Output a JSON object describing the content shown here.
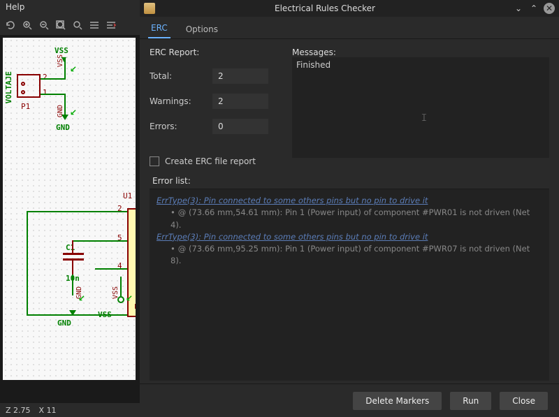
{
  "menubar": {
    "help": "Help"
  },
  "schematic": {
    "vss_top": "VSS",
    "voltaje": "VOLTAJE",
    "p1": "P1",
    "gnd_top": "GND",
    "num1": "1",
    "num2": "2",
    "u1": "U1",
    "u_num2": "2",
    "u_num5": "5",
    "u_num4": "4",
    "c1": "C1",
    "c1_val": "10n",
    "gnd_bottom": "GND",
    "vss_bottom": "VSS",
    "lm": "LM"
  },
  "statusbar": {
    "zoom": "Z 2.75",
    "x": "X  11"
  },
  "dialog": {
    "title": "Electrical Rules Checker",
    "tabs": {
      "erc": "ERC",
      "options": "Options"
    },
    "report_header": "ERC Report:",
    "stats": {
      "total_label": "Total:",
      "total_value": "2",
      "warnings_label": "Warnings:",
      "warnings_value": "2",
      "errors_label": "Errors:",
      "errors_value": "0"
    },
    "create_report": "Create ERC file report",
    "messages_header": "Messages:",
    "messages_text": "Finished",
    "errlist_header": "Error list:",
    "errors": [
      {
        "link": "ErrType(3): Pin connected to some others pins but no pin to drive it",
        "detail": "@ (73.66 mm,54.61 mm): Pin 1 (Power input) of component #PWR01 is not driven (Net 4)."
      },
      {
        "link": "ErrType(3): Pin connected to some others pins but no pin to drive it",
        "detail": "@ (73.66 mm,95.25 mm): Pin 1 (Power input) of component #PWR07 is not driven (Net 8)."
      }
    ],
    "buttons": {
      "delete_markers": "Delete Markers",
      "run": "Run",
      "close": "Close"
    }
  }
}
